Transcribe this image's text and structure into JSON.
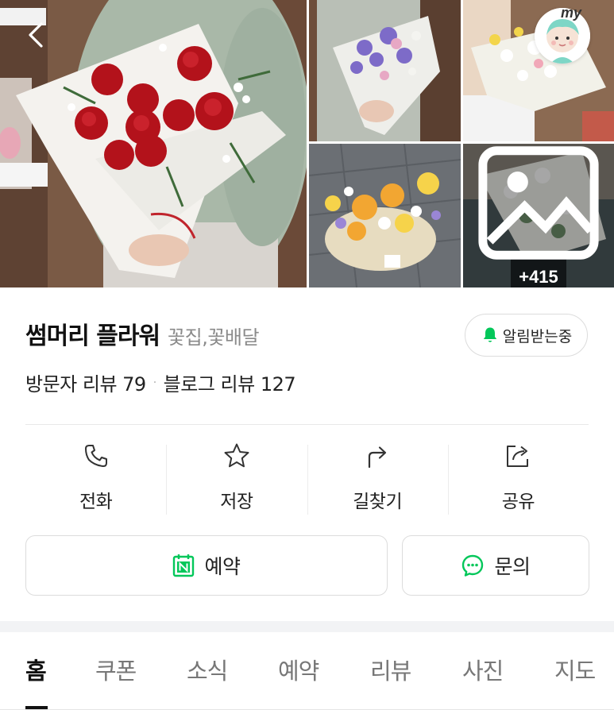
{
  "place": {
    "name": "썸머리 플라워",
    "category": "꽃집,꽃배달",
    "notify_label": "알림받는중",
    "visitor_review_label": "방문자 리뷰 79",
    "blog_review_label": "블로그 리뷰 127",
    "separator": "·"
  },
  "gallery": {
    "more_count": "+415",
    "my_label": "my"
  },
  "actions": [
    {
      "label": "전화",
      "icon": "phone-icon"
    },
    {
      "label": "저장",
      "icon": "star-icon"
    },
    {
      "label": "길찾기",
      "icon": "directions-icon"
    },
    {
      "label": "공유",
      "icon": "share-icon"
    }
  ],
  "buttons": {
    "reserve_label": "예약",
    "inquiry_label": "문의"
  },
  "tabs": [
    "홈",
    "쿠폰",
    "소식",
    "예약",
    "리뷰",
    "사진",
    "지도"
  ],
  "active_tab": "홈",
  "colors": {
    "accent_green": "#03c75a",
    "text_primary": "#111111",
    "text_secondary": "#8a8a8a"
  }
}
